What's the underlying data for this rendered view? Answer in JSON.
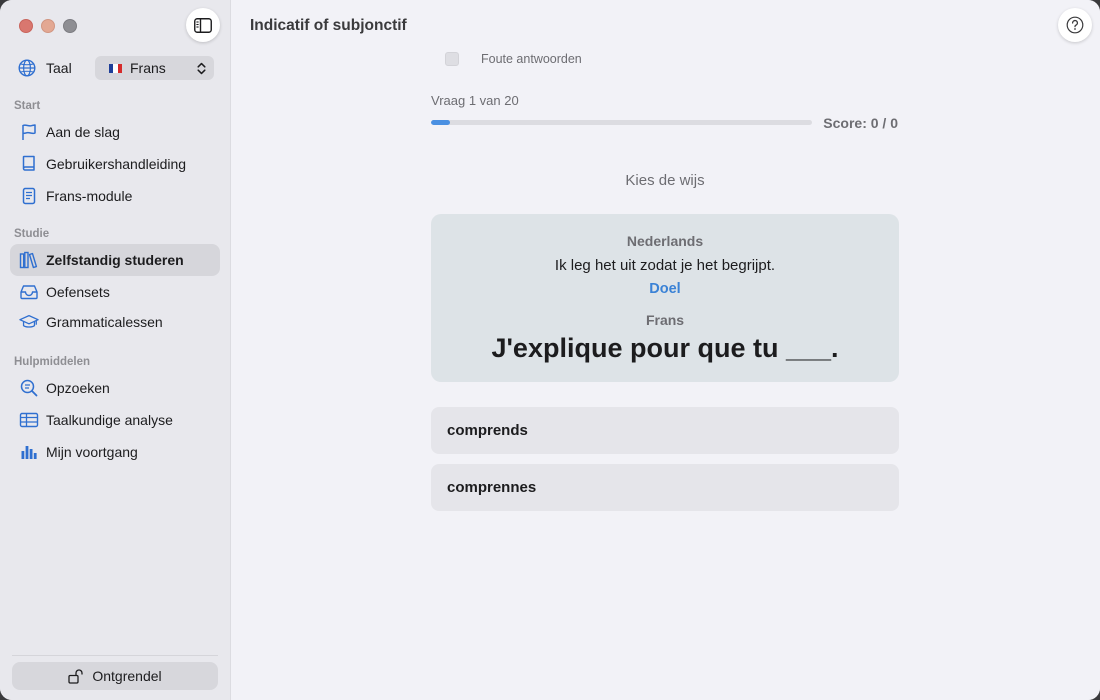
{
  "window": {
    "title": "Indicatif of subjonctif"
  },
  "sidebar": {
    "language_label": "Taal",
    "language_value": "Frans",
    "sections": [
      {
        "title": "Start",
        "items": [
          {
            "label": "Aan de slag",
            "icon": "flag-icon"
          },
          {
            "label": "Gebruikershandleiding",
            "icon": "book-icon"
          },
          {
            "label": "Frans-module",
            "icon": "document-icon"
          }
        ]
      },
      {
        "title": "Studie",
        "items": [
          {
            "label": "Zelfstandig studeren",
            "icon": "books-icon",
            "active": true
          },
          {
            "label": "Oefensets",
            "icon": "tray-icon"
          },
          {
            "label": "Grammaticalessen",
            "icon": "graduation-cap-icon"
          }
        ]
      },
      {
        "title": "Hulpmiddelen",
        "items": [
          {
            "label": "Opzoeken",
            "icon": "magnifier-text-icon"
          },
          {
            "label": "Taalkundige analyse",
            "icon": "table-icon"
          },
          {
            "label": "Mijn voortgang",
            "icon": "bar-chart-icon"
          }
        ]
      }
    ],
    "unlock_label": "Ontgrendel"
  },
  "quiz": {
    "wrong_answers_label": "Foute antwoorden",
    "question_counter": "Vraag 1 van 20",
    "progress": 0.05,
    "score": "Score: 0 / 0",
    "prompt": "Kies de wijs",
    "source_language": "Nederlands",
    "source_sentence": "Ik leg het uit zodat je het begrijpt.",
    "tag": "Doel",
    "target_language": "Frans",
    "target_sentence": "J'explique pour que tu ___.",
    "answers": [
      "comprends",
      "comprennes"
    ]
  },
  "colors": {
    "accent": "#3a82d6",
    "progress": "#4a90e2",
    "card": "#dde3e7"
  }
}
